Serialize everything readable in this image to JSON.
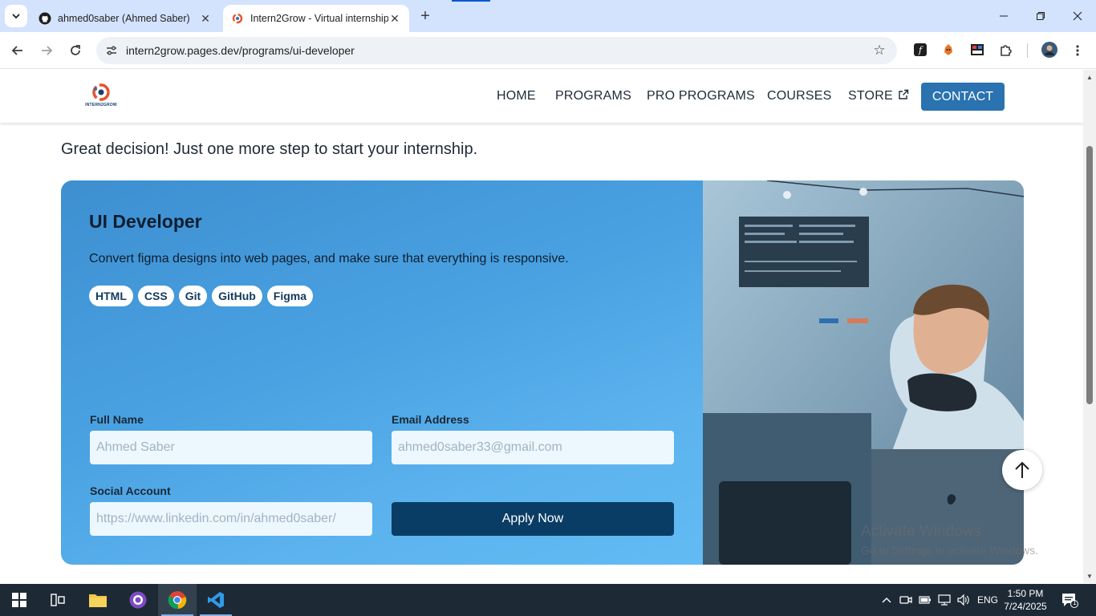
{
  "browser": {
    "tabs": [
      {
        "title": "ahmed0saber (Ahmed Saber)",
        "active": false
      },
      {
        "title": "Intern2Grow - Virtual internship",
        "active": true
      }
    ],
    "url": "intern2grow.pages.dev/programs/ui-developer"
  },
  "site": {
    "logo_text": "INTERN2GROW",
    "nav": [
      {
        "label": "HOME"
      },
      {
        "label": "PROGRAMS"
      },
      {
        "label": "PRO PROGRAMS"
      },
      {
        "label": "COURSES"
      },
      {
        "label": "STORE"
      }
    ],
    "contact_label": "CONTACT"
  },
  "page": {
    "intro": "Great decision! Just one more step to start your internship.",
    "program": {
      "title": "UI Developer",
      "description": "Convert figma designs into web pages, and make sure that everything is responsive.",
      "tags": [
        "HTML",
        "CSS",
        "Git",
        "GitHub",
        "Figma"
      ]
    },
    "form": {
      "full_name": {
        "label": "Full Name",
        "placeholder": "Ahmed Saber"
      },
      "email": {
        "label": "Email Address",
        "placeholder": "ahmed0saber33@gmail.com"
      },
      "social": {
        "label": "Social Account",
        "placeholder": "https://www.linkedin.com/in/ahmed0saber/"
      },
      "submit_label": "Apply Now"
    }
  },
  "watermark": {
    "line1": "Activate Windows",
    "line2": "Go to Settings to activate Windows."
  },
  "taskbar": {
    "language": "ENG",
    "time": "1:50 PM",
    "date": "7/24/2025",
    "notification_count": "1"
  },
  "colors": {
    "accent": "#2a72b0",
    "apply_button": "#0a3d66",
    "tab_strip": "#d3e3fd"
  }
}
